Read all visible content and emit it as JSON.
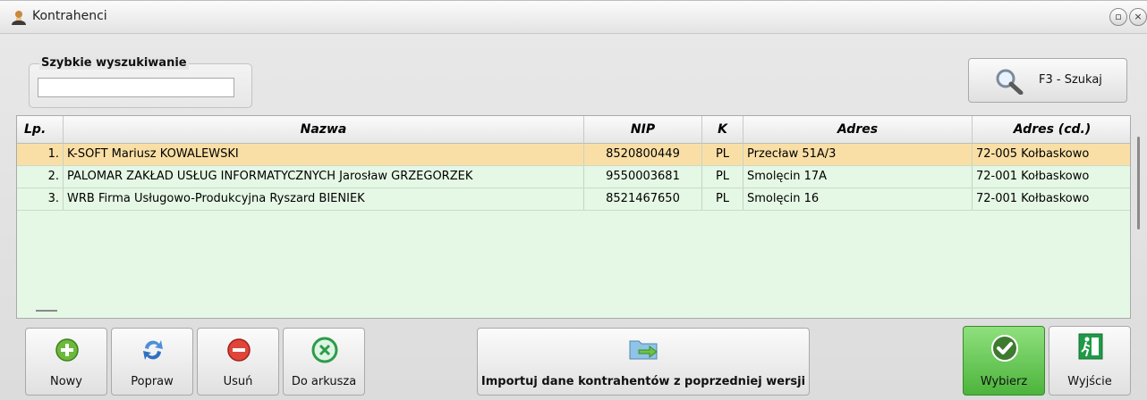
{
  "window": {
    "title": "Kontrahenci"
  },
  "search": {
    "legend": "Szybkie wyszukiwanie",
    "value": "",
    "placeholder": ""
  },
  "search_button": {
    "label": "F3 - Szukaj"
  },
  "table": {
    "columns": [
      "Lp.",
      "Nazwa",
      "NIP",
      "K",
      "Adres",
      "Adres (cd.)"
    ],
    "rows": [
      {
        "lp": "1.",
        "nazwa": "K-SOFT Mariusz KOWALEWSKI",
        "nip": "8520800449",
        "k": "PL",
        "adres": "Przecław 51A/3",
        "adres_cd": "72-005 Kołbaskowo",
        "selected": true
      },
      {
        "lp": "2.",
        "nazwa": "PALOMAR ZAKŁAD USŁUG INFORMATYCZNYCH Jarosław GRZEGORZEK",
        "nip": "9550003681",
        "k": "PL",
        "adres": "Smolęcin 17A",
        "adres_cd": "72-001 Kołbaskowo",
        "selected": false
      },
      {
        "lp": "3.",
        "nazwa": "WRB Firma Usługowo-Produkcyjna Ryszard BIENIEK",
        "nip": "8521467650",
        "k": "PL",
        "adres": "Smolęcin 16",
        "adres_cd": "72-001 Kołbaskowo",
        "selected": false
      }
    ]
  },
  "toolbar": {
    "new_label": "Nowy",
    "edit_label": "Popraw",
    "delete_label": "Usuń",
    "export_label": "Do arkusza",
    "import_label": "Importuj dane kontrahentów z poprzedniej wersji",
    "select_label": "Wybierz",
    "exit_label": "Wyjście"
  },
  "colors": {
    "selected_row": "#f9dfa6",
    "row_bg": "#e5f7e5",
    "select_button": "#5bbf4a"
  },
  "icons": [
    "user-icon",
    "restore-icon",
    "close-icon",
    "magnifier-icon",
    "add-icon",
    "refresh-icon",
    "delete-icon",
    "excel-icon",
    "import-folder-icon",
    "checkmark-icon",
    "exit-icon"
  ]
}
